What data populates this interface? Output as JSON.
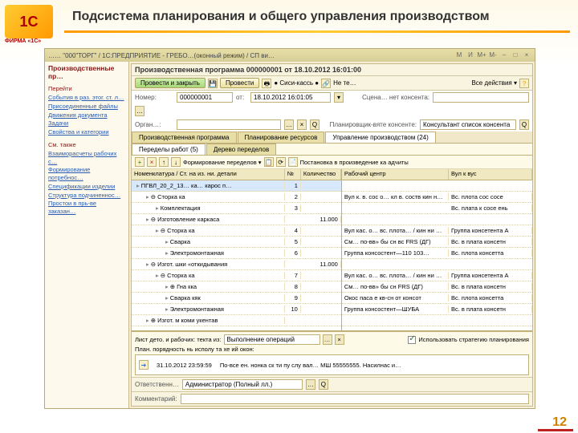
{
  "slide": {
    "title": "Подсистема планирования и общего управления производством",
    "page": "12",
    "logo": "1С",
    "logo_sub": "ФИРМА «1С»"
  },
  "window": {
    "title": "……  \"000\"ТОРГ\" / 1С:ПРЕДПРИЯТИЕ - ГРЕБО…(оконный режим)  / СП ви…"
  },
  "tb_icons": [
    "М",
    "И",
    "М+",
    "М-",
    "–",
    "□",
    "×"
  ],
  "sidebar": {
    "header": "Производственные пр…",
    "sect1": "Перейти",
    "links1": [
      "События в раз. этог. ст. л…",
      "Присоединенные файлы",
      "Движения документа",
      "Задачи",
      "Свойства и категории"
    ],
    "sect2": "См. также",
    "links2": [
      "Взаиморасчеты рабочих с…",
      "Формирование потребнос…",
      "Спецификации изделии",
      "Структура подчиненнос…",
      "Простои в прь-ве заказан…"
    ]
  },
  "doc": {
    "title": "Производственная программа 000000001 от 18.10.2012 16:01:00",
    "btn_main": "Провести и закрыть",
    "btn_p": "Провести",
    "cashcard": "● Сиси-кассь ●",
    "net_lbl": "Не те…",
    "all_actions": "Все действия ▾",
    "row1": {
      "lbl_num": "Номер:",
      "num": "000000001",
      "lbl_on": "от:",
      "date": "18.10.2012 16:01:05",
      "lbl_sc": "Сцена… нет консента:"
    },
    "row2": {
      "lbl_org": "Орган…:",
      "org": "",
      "lbl_plan": "Планировщик-вяте консенте:",
      "plan": "Консультант список консента"
    }
  },
  "tabs": [
    "Производственная программа",
    "Планирование ресурсов",
    "Управление производством (24)"
  ],
  "subtabs": [
    "Переделы работ (5)",
    "Дерево переделов"
  ],
  "subtoolbar": {
    "lbl_form": "Формирование переделов ▾",
    "lbl_post": "Постановка в произведение ка адчиты"
  },
  "left_grid": {
    "headers": [
      "Номенклатура / Ст. на из. ни. детали",
      "№",
      "Количество"
    ],
    "rows": [
      {
        "sel": true,
        "ind": 0,
        "txt": "ПГВЛ_20_2_13… ка… карос п…",
        "n": "1",
        "q": ""
      },
      {
        "ind": 1,
        "txt": "⊖ Сторка ка",
        "n": "2",
        "q": ""
      },
      {
        "ind": 2,
        "txt": "Комплектация",
        "n": "3",
        "q": ""
      },
      {
        "ind": 1,
        "txt": "⊖ Изготовление каркаса",
        "n": "",
        "q": "11.000"
      },
      {
        "ind": 2,
        "txt": "⊖ Сторка ка",
        "n": "4",
        "q": ""
      },
      {
        "ind": 3,
        "txt": "Сварка",
        "n": "5",
        "q": ""
      },
      {
        "ind": 3,
        "txt": "Электромонтажная",
        "n": "6",
        "q": ""
      },
      {
        "ind": 1,
        "txt": "⊖ Изгот. шки «откидывания",
        "n": "",
        "q": "11.000"
      },
      {
        "ind": 2,
        "txt": "⊖ Сторка ка",
        "n": "7",
        "q": ""
      },
      {
        "ind": 3,
        "txt": "⊕ Гна кка",
        "n": "8",
        "q": ""
      },
      {
        "ind": 3,
        "txt": "Сварка кяк",
        "n": "9",
        "q": ""
      },
      {
        "ind": 3,
        "txt": "Электромонтажная",
        "n": "10",
        "q": ""
      },
      {
        "ind": 1,
        "txt": "⊕ Изгот. м коми укентав",
        "n": "",
        "q": ""
      }
    ]
  },
  "right_grid": {
    "headers": [
      "Рабочий центр",
      "Вул к вус"
    ],
    "rows": [
      {
        "a": "",
        "b": ""
      },
      {
        "a": "Вул к. в. сос о… кл в. соств кин ни А",
        "b": "Вс. плота сос сосе"
      },
      {
        "a": "",
        "b": "Вс. плата к сосе ень"
      },
      {
        "a": "",
        "b": ""
      },
      {
        "a": "Вул кас. о… вс. плота… / кин ни А…",
        "b": "Группа консетента А"
      },
      {
        "a": "См… по-вв» бы сн вс FRS (ДГ)",
        "b": "Вс. в плата консетн"
      },
      {
        "a": "Группа консостент—110 103…",
        "b": "Вс. плота консетта"
      },
      {
        "a": "",
        "b": ""
      },
      {
        "a": "Вул кас. о… вс. плота… / кин ни А…",
        "b": "Группа консетента А"
      },
      {
        "a": "См… по-вв» бы сн FRS (ДГ)",
        "b": "Вс. в плата консетн"
      },
      {
        "a": "Окос паса е кв-сн от консот",
        "b": "Вс. плота консетта"
      },
      {
        "a": "Группа консостент—ШУБА",
        "b": "Вс. в плата консетн"
      },
      {
        "a": "",
        "b": ""
      }
    ]
  },
  "bottom": {
    "lbl_list": "Лист дето. и рабочих: текта из:",
    "val_list": "Выполнение операций",
    "chk_use": "Использовать стратегию планирования",
    "lbl_plan": "План. порядность нь исполу та хе ий окон:",
    "mini_date": "31.10.2012 23:59:59",
    "mini_txt": "По-все ен. нонка ск ти пу слу вал…  МШ 55555555. Насилнас и…"
  },
  "footer": {
    "lbl1": "Ответственн…",
    "val1": "Администратор (Полный лл.)",
    "lbl2": "Комментарий:"
  }
}
